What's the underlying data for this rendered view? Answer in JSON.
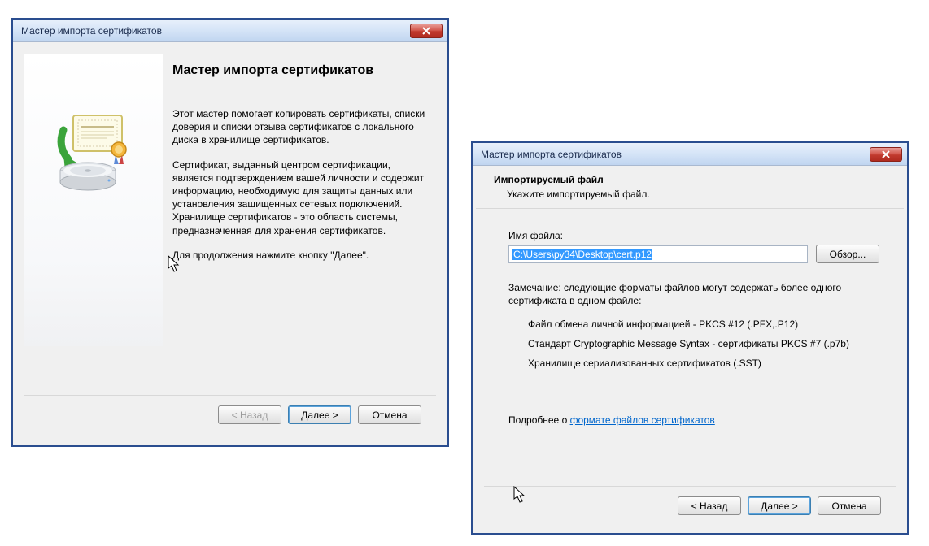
{
  "dialog1": {
    "title": "Мастер импорта сертификатов",
    "main_heading": "Мастер импорта сертификатов",
    "para1": "Этот мастер помогает копировать сертификаты, списки доверия и списки отзыва сертификатов с локального диска в хранилище сертификатов.",
    "para2": "Сертификат, выданный центром сертификации, является подтверждением вашей личности и содержит информацию, необходимую для защиты данных или установления защищенных сетевых подключений. Хранилище сертификатов - это область системы, предназначенная для хранения сертификатов.",
    "para3": "Для продолжения нажмите кнопку \"Далее\".",
    "btn_back": "< Назад",
    "btn_next": "Далее >",
    "btn_cancel": "Отмена"
  },
  "dialog2": {
    "title": "Мастер импорта сертификатов",
    "heading": "Импортируемый файл",
    "sub": "Укажите импортируемый файл.",
    "file_label": "Имя файла:",
    "file_value": "C:\\Users\\py34\\Desktop\\cert.p12",
    "browse": "Обзор...",
    "note": "Замечание: следующие форматы файлов могут содержать более одного сертификата в одном файле:",
    "fmt1": "Файл обмена личной информацией - PKCS #12 (.PFX,.P12)",
    "fmt2": "Стандарт Cryptographic Message Syntax - сертификаты PKCS #7 (.p7b)",
    "fmt3": "Хранилище сериализованных сертификатов (.SST)",
    "more_prefix": "Подробнее о ",
    "more_link": "формате файлов сертификатов",
    "btn_back": "< Назад",
    "btn_next": "Далее >",
    "btn_cancel": "Отмена"
  }
}
